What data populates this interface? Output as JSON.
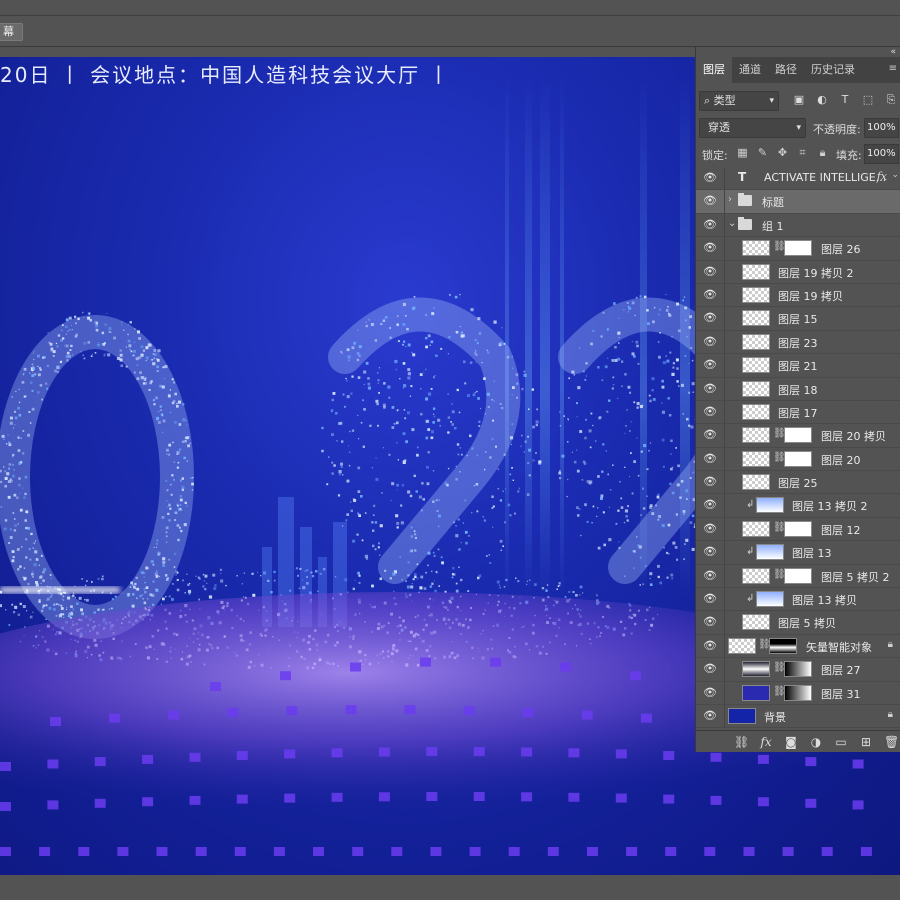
{
  "toolbar": {
    "screen_button": "幕"
  },
  "canvas": {
    "banner_text": "20日 丨 会议地点：中国人造科技会议大厅 丨",
    "big_number": "022",
    "colors": {
      "bg_deep": "#0e1880",
      "bg_mid": "#1a2bb0",
      "particle": "#cfe0ff",
      "glow": "#6fb0ff",
      "ground_purple": "#7a4fd8",
      "dash_purple": "#6a3cf0"
    }
  },
  "panel": {
    "tabs": [
      "图层",
      "通道",
      "路径",
      "历史记录"
    ],
    "active_tab": "图层",
    "filter_kind": "类型",
    "blend_mode": "穿透",
    "opacity_label": "不透明度:",
    "opacity_value": "100%",
    "lock_label": "锁定:",
    "fill_label": "填充:",
    "fill_value": "100%",
    "layers": [
      {
        "name": "ACTIVATE INTELLIGE...",
        "kind": "text",
        "fx": "fx"
      },
      {
        "name": "标题",
        "kind": "group-collapsed"
      },
      {
        "name": "组 1",
        "kind": "group-open"
      },
      {
        "name": "图层 26",
        "kind": "masked"
      },
      {
        "name": "图层 19 拷贝 2",
        "kind": "plain"
      },
      {
        "name": "图层 19 拷贝",
        "kind": "plain"
      },
      {
        "name": "图层 15",
        "kind": "plain"
      },
      {
        "name": "图层 23",
        "kind": "plain"
      },
      {
        "name": "图层 21",
        "kind": "plain"
      },
      {
        "name": "图层 18",
        "kind": "plain"
      },
      {
        "name": "图层 17",
        "kind": "plain"
      },
      {
        "name": "图层 20 拷贝",
        "kind": "masked"
      },
      {
        "name": "图层 20",
        "kind": "masked"
      },
      {
        "name": "图层 25",
        "kind": "plain"
      },
      {
        "name": "图层 13 拷贝 2",
        "kind": "clipped"
      },
      {
        "name": "图层 12",
        "kind": "masked"
      },
      {
        "name": "图层 13",
        "kind": "clipped"
      },
      {
        "name": "图层 5 拷贝 2",
        "kind": "masked"
      },
      {
        "name": "图层 13 拷贝",
        "kind": "clipped"
      },
      {
        "name": "图层 5 拷贝",
        "kind": "plain"
      },
      {
        "name": "矢量智能对象",
        "kind": "masked-locked"
      },
      {
        "name": "图层 27",
        "kind": "masked"
      },
      {
        "name": "图层 31",
        "kind": "masked"
      },
      {
        "name": "背景",
        "kind": "background-locked"
      }
    ],
    "footer_icons": [
      "link-icon",
      "fx-icon",
      "add-mask-icon",
      "adjustment-icon",
      "new-group-icon",
      "new-layer-icon",
      "delete-icon"
    ]
  }
}
